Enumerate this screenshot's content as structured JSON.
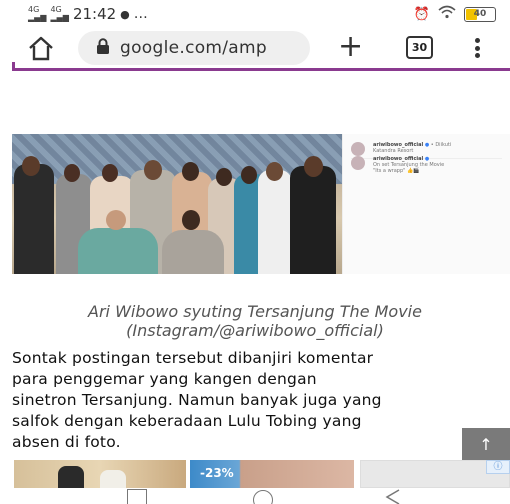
{
  "status_bar": {
    "signal_label_1": "4G",
    "signal_label_2": "4G",
    "time": "21:42",
    "extra": "…",
    "battery": "40",
    "battery_level": 0.4
  },
  "browser": {
    "url": "google.com/amp",
    "tab_count": "30"
  },
  "photo": {
    "ig_username_1": "ariwibowo_official",
    "ig_meta_1": "• Diikuti",
    "ig_location": "Katandra Resort",
    "ig_username_2": "ariwibowo_official",
    "ig_comment_1": "On set Tersanjung the Movie",
    "ig_comment_2": "\"Its a wrapp\""
  },
  "caption": {
    "line1": "Ari Wibowo syuting Tersanjung The Movie",
    "line2": "(Instagram/@ariwibowo_official)"
  },
  "article": {
    "lines": [
      "Sontak postingan tersebut dibanjiri komentar",
      "para penggemar yang kangen dengan",
      "sinetron Tersanjung. Namun banyak juga yang",
      "salfok dengan keberadaan Lulu Tobing yang",
      "absen di foto."
    ]
  },
  "scroll_top": "↑",
  "thumbnails": {
    "discount": "-23%",
    "info": "ⓘ"
  },
  "colors": {
    "accent_line": "#8a3a8f",
    "battery_fill": "#f2c200"
  }
}
